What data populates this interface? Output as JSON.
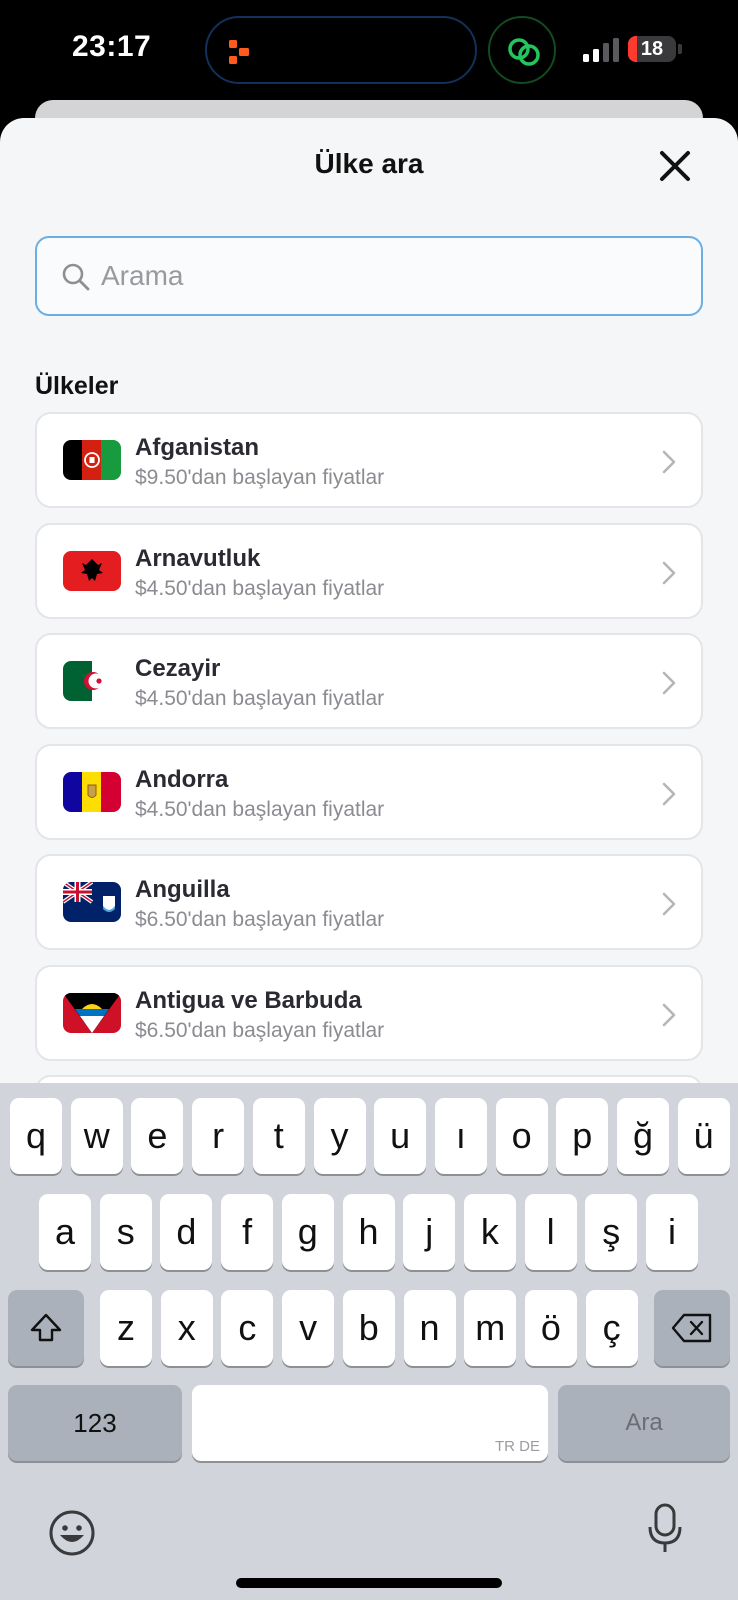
{
  "status_bar": {
    "time": "23:17",
    "battery_level": "18",
    "battery_fraction": 0.18,
    "chat_bubble_color": "#22c55e"
  },
  "sheet": {
    "title": "Ülke ara",
    "search": {
      "placeholder": "Arama",
      "value": ""
    },
    "section_title": "Ülkeler"
  },
  "countries": [
    {
      "name": "Afganistan",
      "price": "$9.50'dan başlayan fiyatlar",
      "flag": "flag-afghanistan-icon"
    },
    {
      "name": "Arnavutluk",
      "price": "$4.50'dan başlayan fiyatlar",
      "flag": "flag-albania-icon"
    },
    {
      "name": "Cezayir",
      "price": "$4.50'dan başlayan fiyatlar",
      "flag": "flag-algeria-icon"
    },
    {
      "name": "Andorra",
      "price": "$4.50'dan başlayan fiyatlar",
      "flag": "flag-andorra-icon"
    },
    {
      "name": "Anguilla",
      "price": "$6.50'dan başlayan fiyatlar",
      "flag": "flag-anguilla-icon"
    },
    {
      "name": "Antigua ve Barbuda",
      "price": "$6.50'dan başlayan fiyatlar",
      "flag": "flag-antigua-barbuda-icon"
    }
  ],
  "keyboard": {
    "row1": [
      "q",
      "w",
      "e",
      "r",
      "t",
      "y",
      "u",
      "ı",
      "o",
      "p",
      "ğ",
      "ü"
    ],
    "row2": [
      "a",
      "s",
      "d",
      "f",
      "g",
      "h",
      "j",
      "k",
      "l",
      "ş",
      "i"
    ],
    "row3": [
      "z",
      "x",
      "c",
      "v",
      "b",
      "n",
      "m",
      "ö",
      "ç"
    ],
    "numbers_label": "123",
    "search_label": "Ara",
    "language_indicator": "TR DE"
  }
}
